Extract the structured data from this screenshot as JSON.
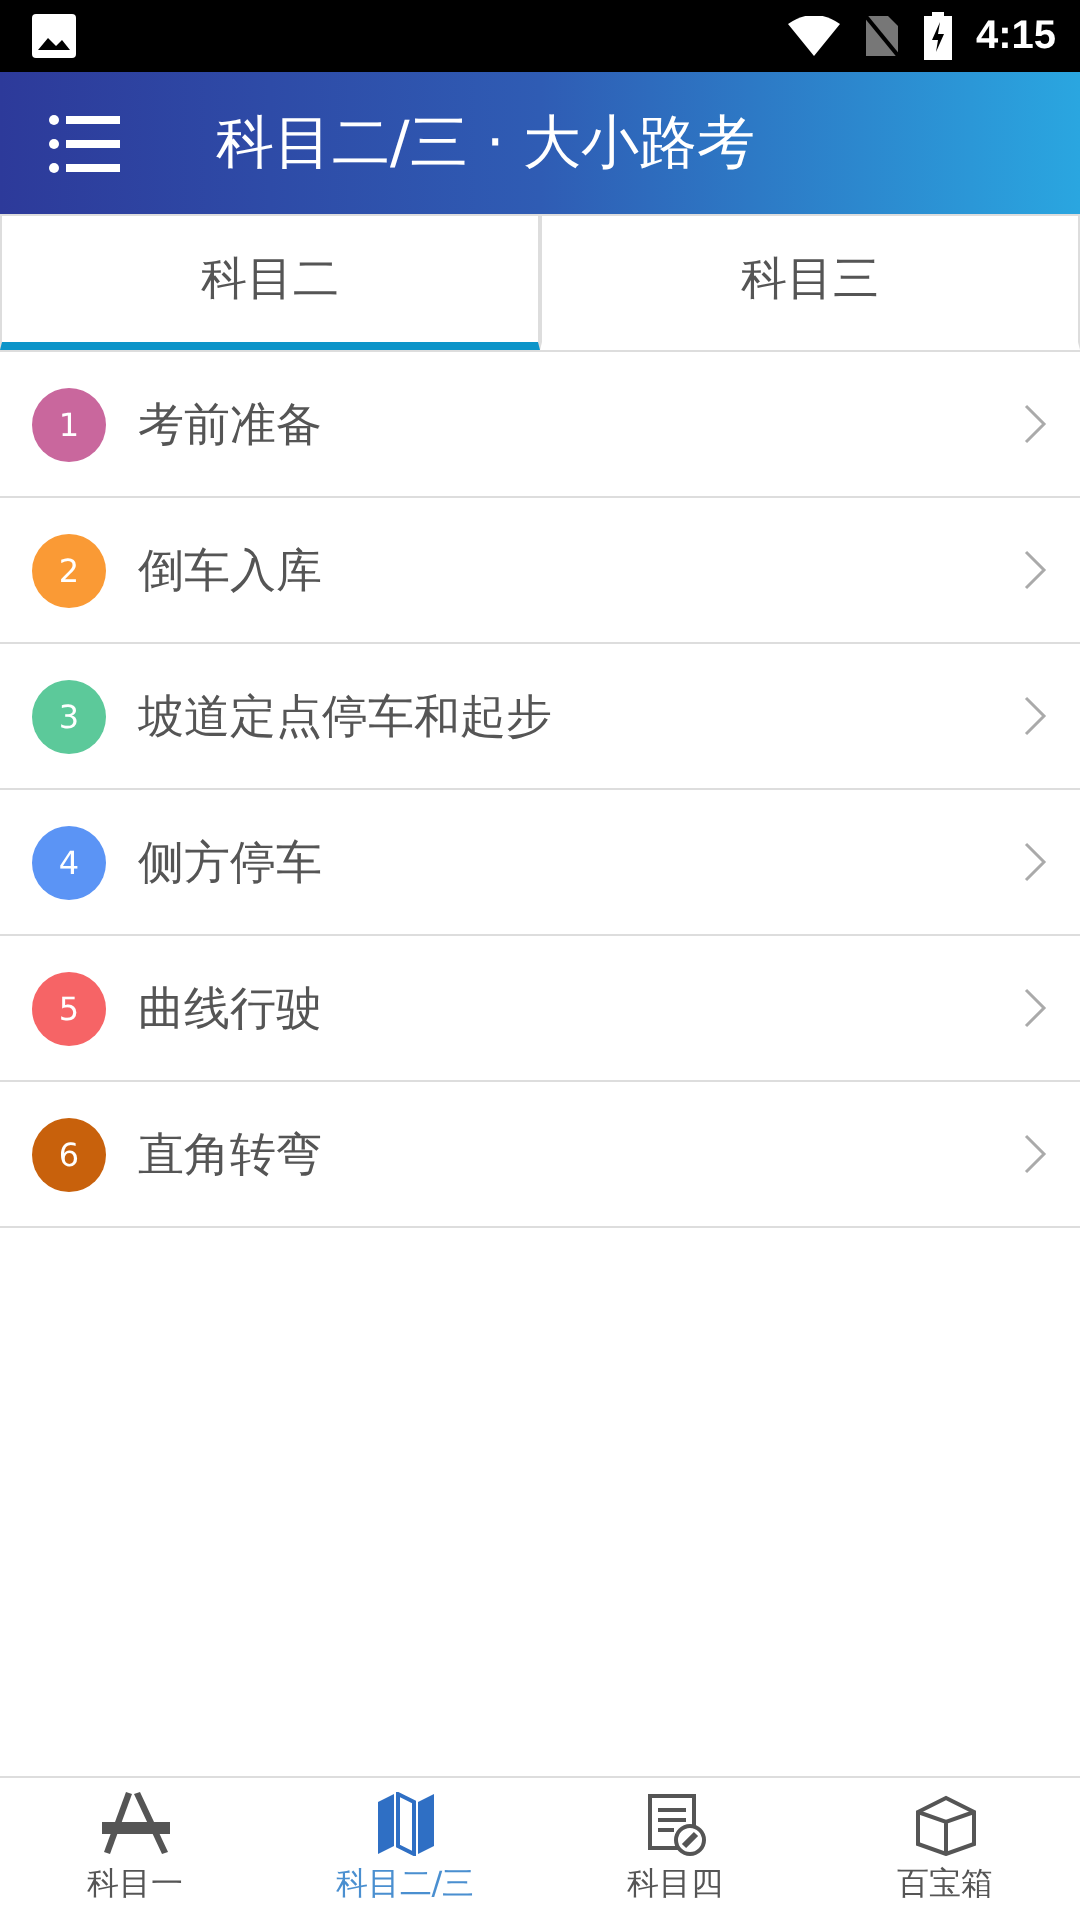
{
  "status_bar": {
    "time": "4:15"
  },
  "header": {
    "title": "科目二/三 · 大小路考"
  },
  "tabs": [
    {
      "label": "科目二",
      "selected": true
    },
    {
      "label": "科目三",
      "selected": false
    }
  ],
  "items": [
    {
      "number": "1",
      "label": "考前准备",
      "color": "#c9679d"
    },
    {
      "number": "2",
      "label": "倒车入库",
      "color": "#fa9a35"
    },
    {
      "number": "3",
      "label": "坡道定点停车和起步",
      "color": "#5cc99a"
    },
    {
      "number": "4",
      "label": "侧方停车",
      "color": "#5b94f5"
    },
    {
      "number": "5",
      "label": "曲线行驶",
      "color": "#f66466"
    },
    {
      "number": "6",
      "label": "直角转弯",
      "color": "#c8610c"
    }
  ],
  "bottom_nav": [
    {
      "label": "科目一",
      "kind": "appstore",
      "selected": false
    },
    {
      "label": "科目二/三",
      "kind": "map",
      "selected": true
    },
    {
      "label": "科目四",
      "kind": "form",
      "selected": false
    },
    {
      "label": "百宝箱",
      "kind": "box",
      "selected": false
    }
  ]
}
